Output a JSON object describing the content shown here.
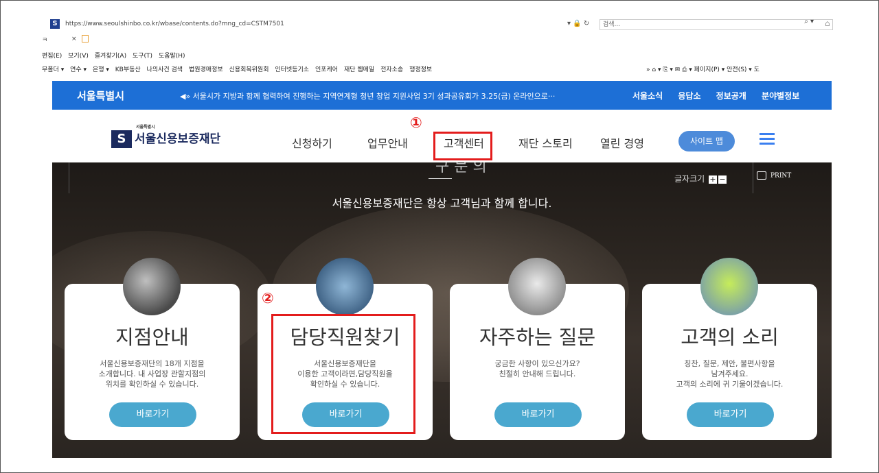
{
  "browser": {
    "url": "https://www.seoulshinbo.co.kr/wbase/contents.do?mng_cd=CSTM7501",
    "search_placeholder": "검색...",
    "tab_title": "ㅋ",
    "tab_close": "×",
    "menu": [
      "편집(E)",
      "보기(V)",
      "즐겨찾기(A)",
      "도구(T)",
      "도움말(H)"
    ],
    "favorites": [
      "무폴더 ▾",
      "연수 ▾",
      "은행 ▾",
      "KB부동산",
      "나의사건 검색",
      "법원경매정보",
      "신용회복위원회",
      "인터넷등기소",
      "인포케어",
      "재단 웹메일",
      "전자소송",
      "행정정보"
    ],
    "toolbar_right": "»  ⌂ ▾  ⎘ ▾  ✉  ⎙ ▾  페이지(P) ▾  안전(S) ▾  도"
  },
  "site_top": {
    "city_logo": "서울특별시",
    "news": "◀» 서울시가 지방과 함께 협력하여 진행하는 지역연계형 청년 창업 지원사업 3기 성과공유회가 3.25(금) 온라인으로···",
    "links": [
      "서울소식",
      "응답소",
      "정보공개",
      "분야별정보"
    ]
  },
  "nav": {
    "brand": "서울신용보증재단",
    "brand_small": "서울특별시",
    "items": [
      "신청하기",
      "업무안내",
      "고객센터",
      "재단 스토리",
      "열린 경영"
    ],
    "sitemap": "사이트 맵"
  },
  "hero": {
    "ghost": "구 문 의",
    "tagline": "서울신용보증재단은 항상 고객님과 함께 합니다.",
    "fontsize_label": "글자크기",
    "print_label": "PRINT"
  },
  "cards": [
    {
      "title": "지점안내",
      "desc": [
        "서울신용보증재단의 18개 지점을",
        "소개합니다. 내 사업장 관할지점의",
        "위치를 확인하실 수 있습니다."
      ],
      "button": "바로가기"
    },
    {
      "title": "담당직원찾기",
      "desc": [
        "서울신용보증재단을",
        "이용한 고객이라면,담당직원을",
        "확인하실 수 있습니다."
      ],
      "button": "바로가기"
    },
    {
      "title": "자주하는 질문",
      "desc": [
        "궁금한 사항이 있으신가요?",
        "친절히 안내해 드립니다."
      ],
      "button": "바로가기"
    },
    {
      "title": "고객의 소리",
      "desc": [
        "칭찬, 질문, 제안, 불편사항을",
        "남겨주세요.",
        "고객의 소리에 귀 기울이겠습니다."
      ],
      "button": "바로가기"
    }
  ],
  "annotations": {
    "step1": "①",
    "step2": "②",
    "color": "#e31c1c"
  }
}
